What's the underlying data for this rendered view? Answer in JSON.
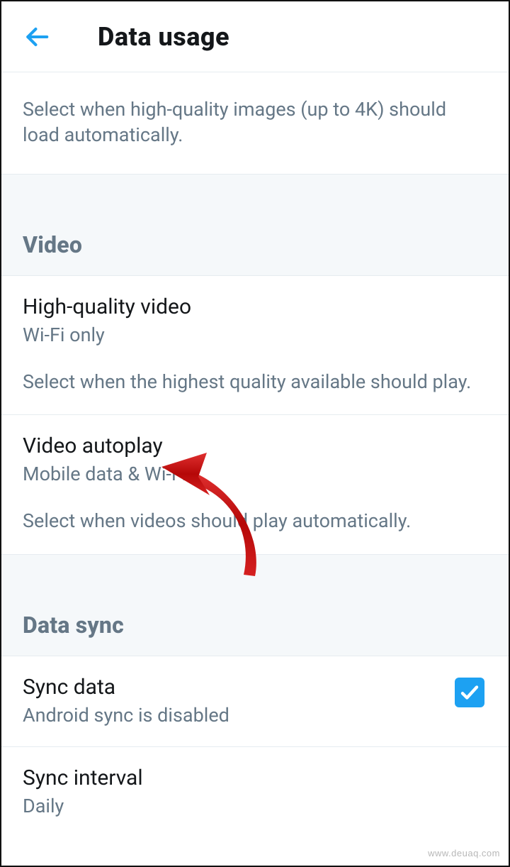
{
  "header": {
    "title": "Data usage"
  },
  "top_description": "Select when high-quality images (up to 4K) should load automatically.",
  "sections": {
    "video": {
      "title": "Video",
      "items": [
        {
          "title": "High-quality video",
          "subtitle": "Wi-Fi only",
          "description": "Select when the highest quality available should play."
        },
        {
          "title": "Video autoplay",
          "subtitle": "Mobile data & Wi-Fi",
          "description": "Select when videos should play automatically."
        }
      ]
    },
    "data_sync": {
      "title": "Data sync",
      "items": [
        {
          "title": "Sync data",
          "subtitle": "Android sync is disabled",
          "checked": true
        },
        {
          "title": "Sync interval",
          "subtitle": "Daily"
        }
      ]
    }
  },
  "watermark": "www.deuaq.com"
}
